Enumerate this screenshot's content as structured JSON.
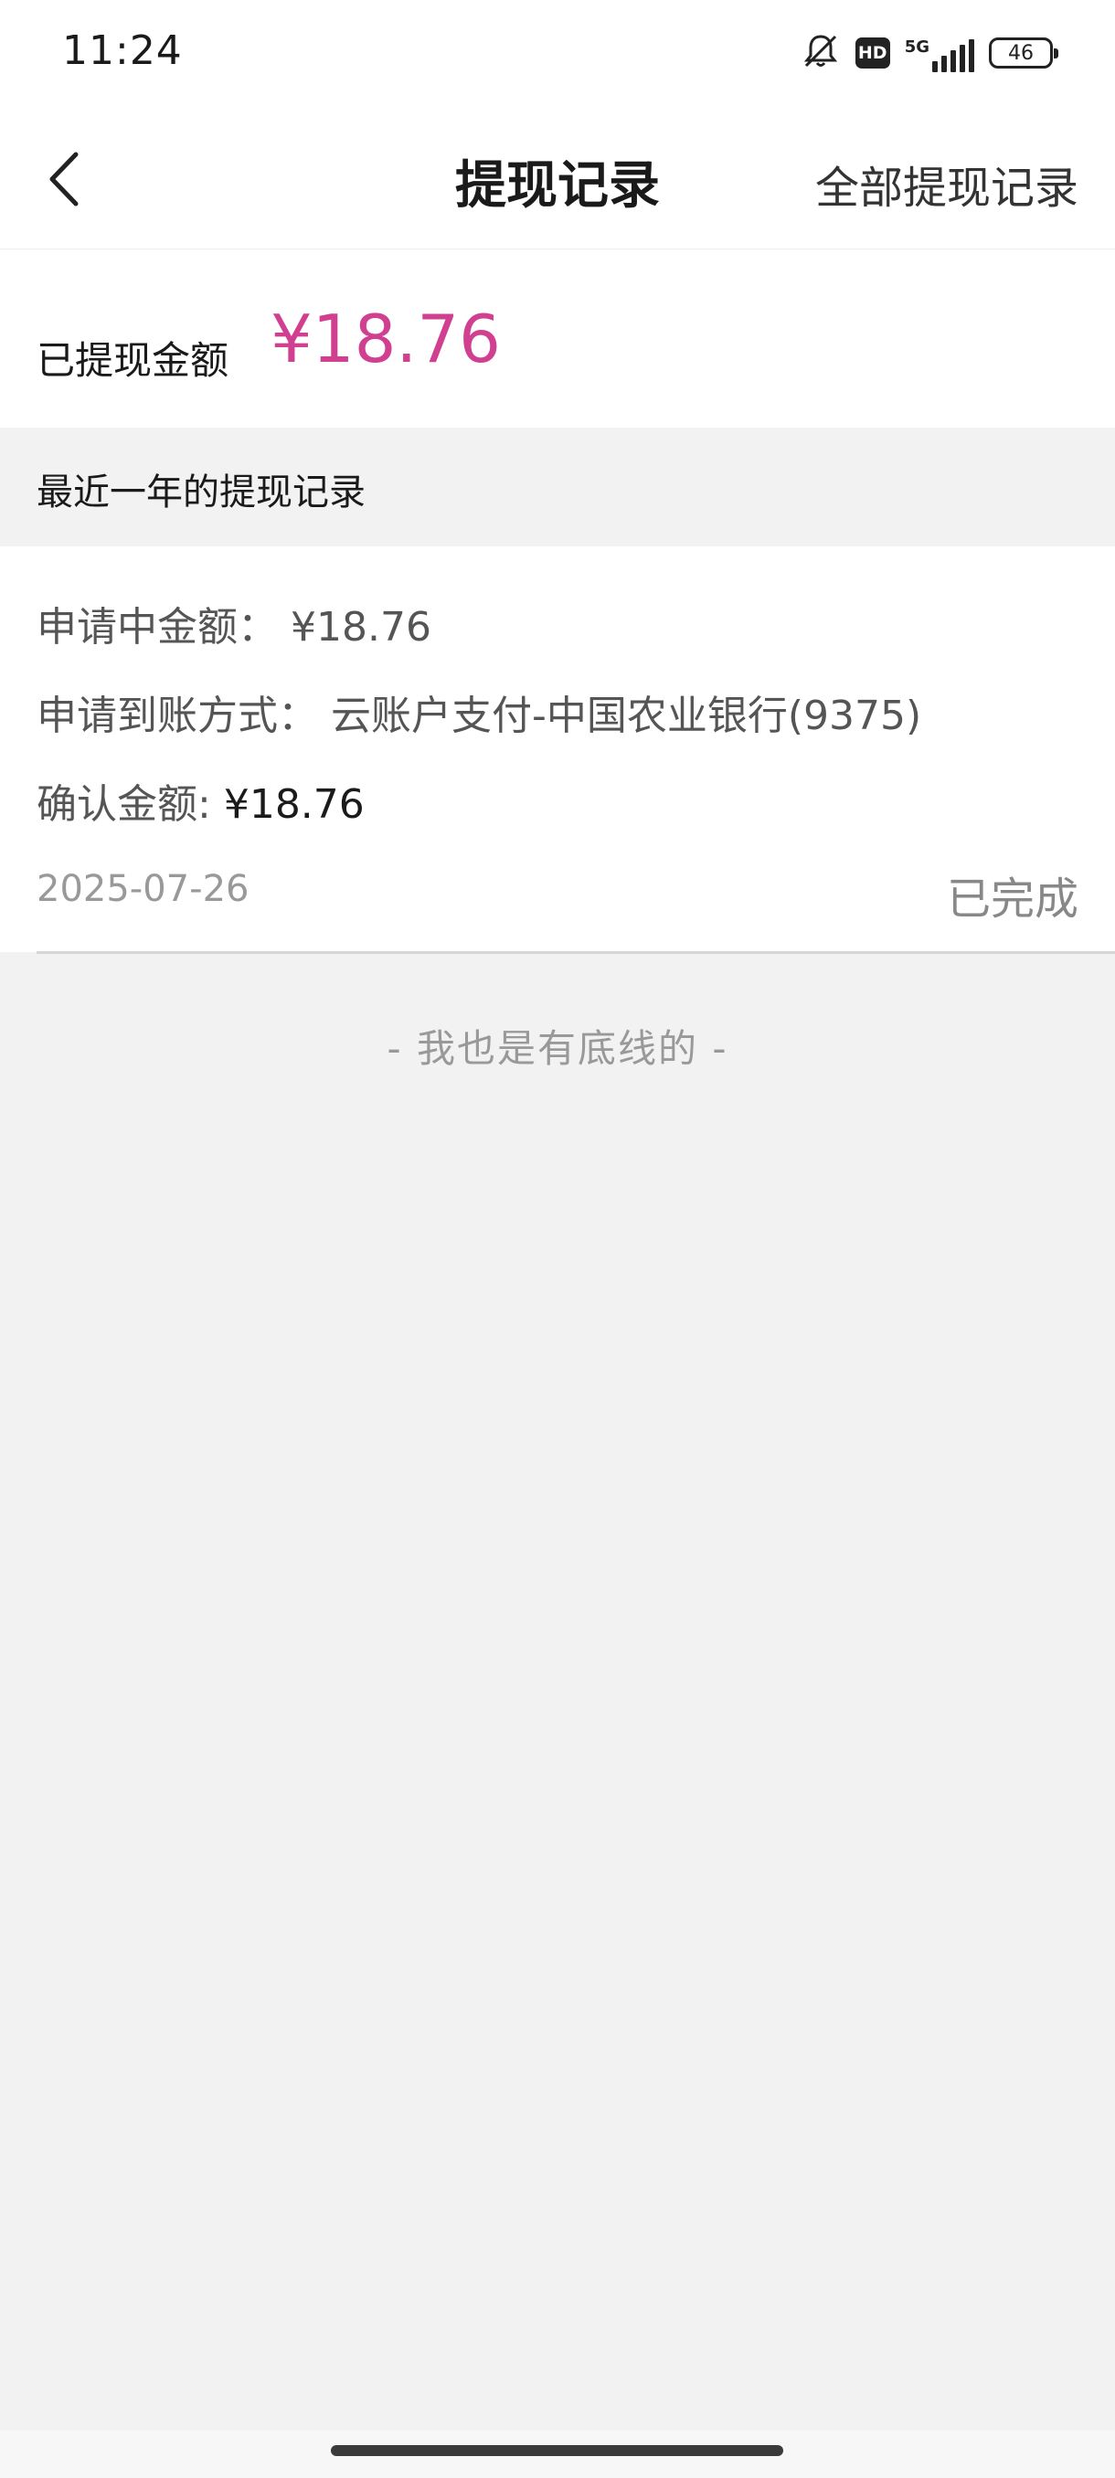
{
  "status_bar": {
    "time": "11:24",
    "hd_label": "HD",
    "network_label": "5G",
    "battery_level": "46"
  },
  "nav": {
    "title": "提现记录",
    "right_action": "全部提现记录",
    "back_icon": "chevron-left-icon"
  },
  "summary": {
    "label": "已提现金额",
    "amount": "¥18.76"
  },
  "section": {
    "title": "最近一年的提现记录"
  },
  "record": {
    "pending_label": "申请中金额：",
    "pending_value": "¥18.76",
    "method_label": "申请到账方式：",
    "method_value": "云账户支付-中国农业银行(9375)",
    "confirm_label": "确认金额:",
    "confirm_value": "¥18.76",
    "date": "2025-07-26",
    "status": "已完成"
  },
  "footer": {
    "end_text": "- 我也是有底线的 -"
  },
  "colors": {
    "accent_amount": "#d13f91",
    "page_bg": "#f2f2f2"
  }
}
